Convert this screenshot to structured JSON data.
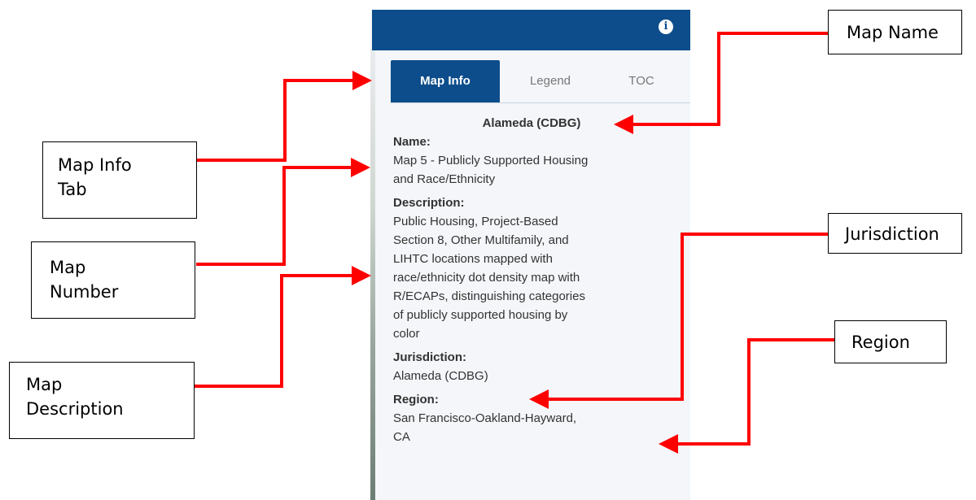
{
  "panel": {
    "info_icon": "i",
    "tabs": [
      {
        "label": "Map Info",
        "active": true
      },
      {
        "label": "Legend",
        "active": false
      },
      {
        "label": "TOC",
        "active": false
      }
    ],
    "title": "Alameda (CDBG)",
    "name_label": "Name:",
    "name_lines": [
      "Map 5 - Publicly Supported Housing",
      "and Race/Ethnicity"
    ],
    "description_label": "Description:",
    "description_lines": [
      "Public Housing, Project-Based",
      "Section 8, Other Multifamily, and",
      "LIHTC locations mapped with",
      "race/ethnicity dot density map with",
      "R/ECAPs, distinguishing categories",
      "of publicly supported housing by",
      "color"
    ],
    "jurisdiction_label": "Jurisdiction:",
    "jurisdiction": "Alameda (CDBG)",
    "region_label": "Region:",
    "region_lines": [
      "San Francisco-Oakland-Hayward,",
      "CA"
    ]
  },
  "callouts": {
    "map_name": "Map Name",
    "map_info_tab": [
      "Map Info",
      "Tab"
    ],
    "map_number": [
      "Map",
      "Number"
    ],
    "map_description": [
      "Map",
      "Description"
    ],
    "jurisdiction": "Jurisdiction",
    "region": "Region"
  },
  "colors": {
    "header": "#0d4d8b",
    "arrow": "#ff0000",
    "panel_bg": "#f4f6f9"
  }
}
